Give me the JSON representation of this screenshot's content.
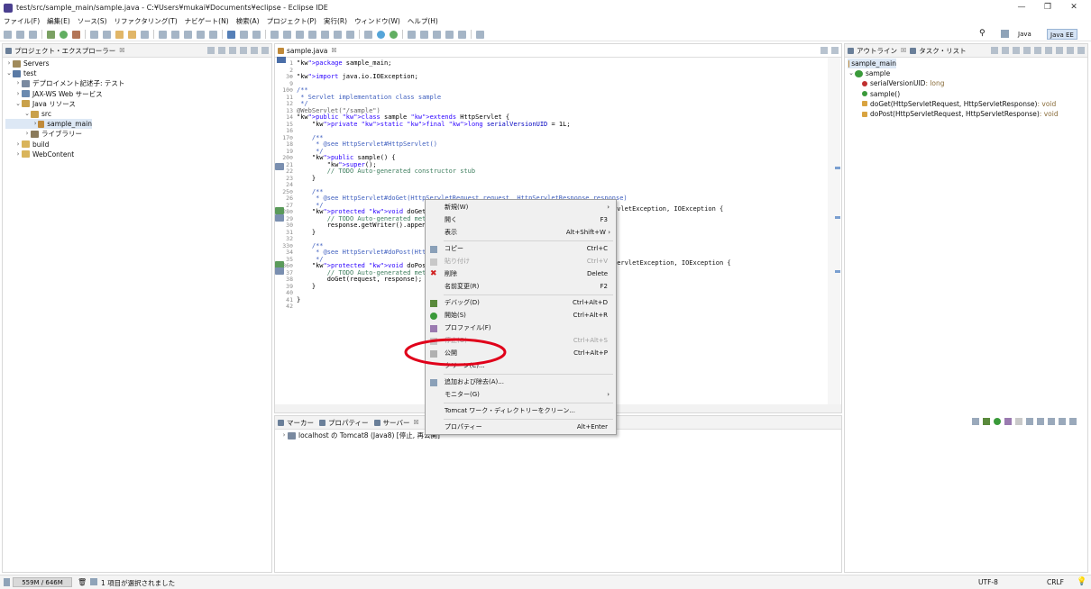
{
  "window": {
    "title": "test/src/sample_main/sample.java - C:¥Users¥mukai¥Documents¥eclipse - Eclipse IDE"
  },
  "menu": [
    "ファイル(F)",
    "編集(E)",
    "ソース(S)",
    "リファクタリング(T)",
    "ナビゲート(N)",
    "検索(A)",
    "プロジェクト(P)",
    "実行(R)",
    "ウィンドウ(W)",
    "ヘルプ(H)"
  ],
  "perspectives": {
    "java": "Java",
    "javaee": "Java EE"
  },
  "explorer": {
    "tab": "プロジェクト・エクスプローラー",
    "items": [
      "Servers",
      "test",
      "デプロイメント記述子: テスト",
      "JAX-WS Web サービス",
      "Java リソース",
      "src",
      "sample_main",
      "ライブラリー",
      "build",
      "WebContent"
    ]
  },
  "editor": {
    "tab": "sample.java",
    "line_numbers": [
      "1",
      "2",
      "3⊕",
      "9",
      "10⊖",
      "11",
      "12",
      "13",
      "14",
      "15",
      "16",
      "17⊖",
      "18",
      "19",
      "20⊖",
      "21",
      "22",
      "23",
      "24",
      "25⊖",
      "26",
      "27",
      "28⊖",
      "29",
      "30",
      "31",
      "32",
      "33⊖",
      "34",
      "35",
      "36⊖",
      "37",
      "38",
      "39",
      "40",
      "41",
      "42"
    ],
    "lines": [
      "package sample_main;",
      "",
      "import java.io.IOException;",
      "",
      "/**",
      " * Servlet implementation class sample",
      " */",
      "@WebServlet(\"/sample\")",
      "public class sample extends HttpServlet {",
      "    private static final long serialVersionUID = 1L;",
      "",
      "    /**",
      "     * @see HttpServlet#HttpServlet()",
      "     */",
      "    public sample() {",
      "        super();",
      "        // TODO Auto-generated constructor stub",
      "    }",
      "",
      "    /**",
      "     * @see HttpServlet#doGet(HttpServletRequest request, HttpServletResponse response)",
      "     */",
      "    protected void doGet(HttpServlet",
      "        // TODO Auto-generated method",
      "        response.getWriter().append(\"S",
      "    }",
      "",
      "    /**",
      "     * @see HttpServlet#doPost(HttpSe",
      "     */",
      "    protected void doPost(HttpServle",
      "        // TODO Auto-generated method",
      "        doGet(request, response);",
      "    }",
      "",
      "}",
      ""
    ],
    "line28_tail": "rvletException, IOException {",
    "line36_tail": "ServletException, IOException {"
  },
  "outline": {
    "tabs": [
      "アウトライン",
      "タスク・リスト"
    ],
    "items": [
      {
        "name": "sample_main",
        "type": ""
      },
      {
        "name": "sample",
        "type": ""
      },
      {
        "name": "serialVersionUID",
        "type": " : long"
      },
      {
        "name": "sample()",
        "type": ""
      },
      {
        "name": "doGet(HttpServletRequest, HttpServletResponse)",
        "type": " : void"
      },
      {
        "name": "doPost(HttpServletRequest, HttpServletResponse)",
        "type": " : void"
      }
    ]
  },
  "bottom": {
    "tabs": [
      "マーカー",
      "プロパティー",
      "サーバー",
      "デ"
    ],
    "server_entry": "localhost の Tomcat8 (Java8)  [停止, 再公開]"
  },
  "context_menu": [
    {
      "label": "新規(W)",
      "key": "",
      "arrow": "›"
    },
    {
      "label": "開く",
      "key": "F3",
      "arrow": ""
    },
    {
      "label": "表示",
      "key": "Alt+Shift+W ›",
      "arrow": ""
    },
    {
      "label": "コピー",
      "key": "Ctrl+C",
      "arrow": ""
    },
    {
      "label": "貼り付け",
      "key": "Ctrl+V",
      "arrow": ""
    },
    {
      "label": "削除",
      "key": "Delete",
      "arrow": ""
    },
    {
      "label": "名前変更(R)",
      "key": "F2",
      "arrow": ""
    },
    {
      "label": "デバッグ(D)",
      "key": "Ctrl+Alt+D",
      "arrow": ""
    },
    {
      "label": "開始(S)",
      "key": "Ctrl+Alt+R",
      "arrow": ""
    },
    {
      "label": "プロファイル(F)",
      "key": "",
      "arrow": ""
    },
    {
      "label": "停止(O)",
      "key": "Ctrl+Alt+S",
      "arrow": ""
    },
    {
      "label": "公開",
      "key": "Ctrl+Alt+P",
      "arrow": ""
    },
    {
      "label": "クリーン(C)...",
      "key": "",
      "arrow": ""
    },
    {
      "label": "追加および除去(A)...",
      "key": "",
      "arrow": ""
    },
    {
      "label": "モニター(G)",
      "key": "",
      "arrow": "›"
    },
    {
      "label": "Tomcat ワーク・ディレクトリーをクリーン...",
      "key": "",
      "arrow": ""
    },
    {
      "label": "プロパティー",
      "key": "Alt+Enter",
      "arrow": ""
    }
  ],
  "status": {
    "memory": "559M / 646M",
    "selection": "1 項目が選択されました",
    "encoding": "UTF-8",
    "line_ending": "CRLF"
  },
  "colors": {
    "annotation_red": "#e0001a",
    "selection_blue": "#dde8f5",
    "accent": "#4a6ea8"
  }
}
